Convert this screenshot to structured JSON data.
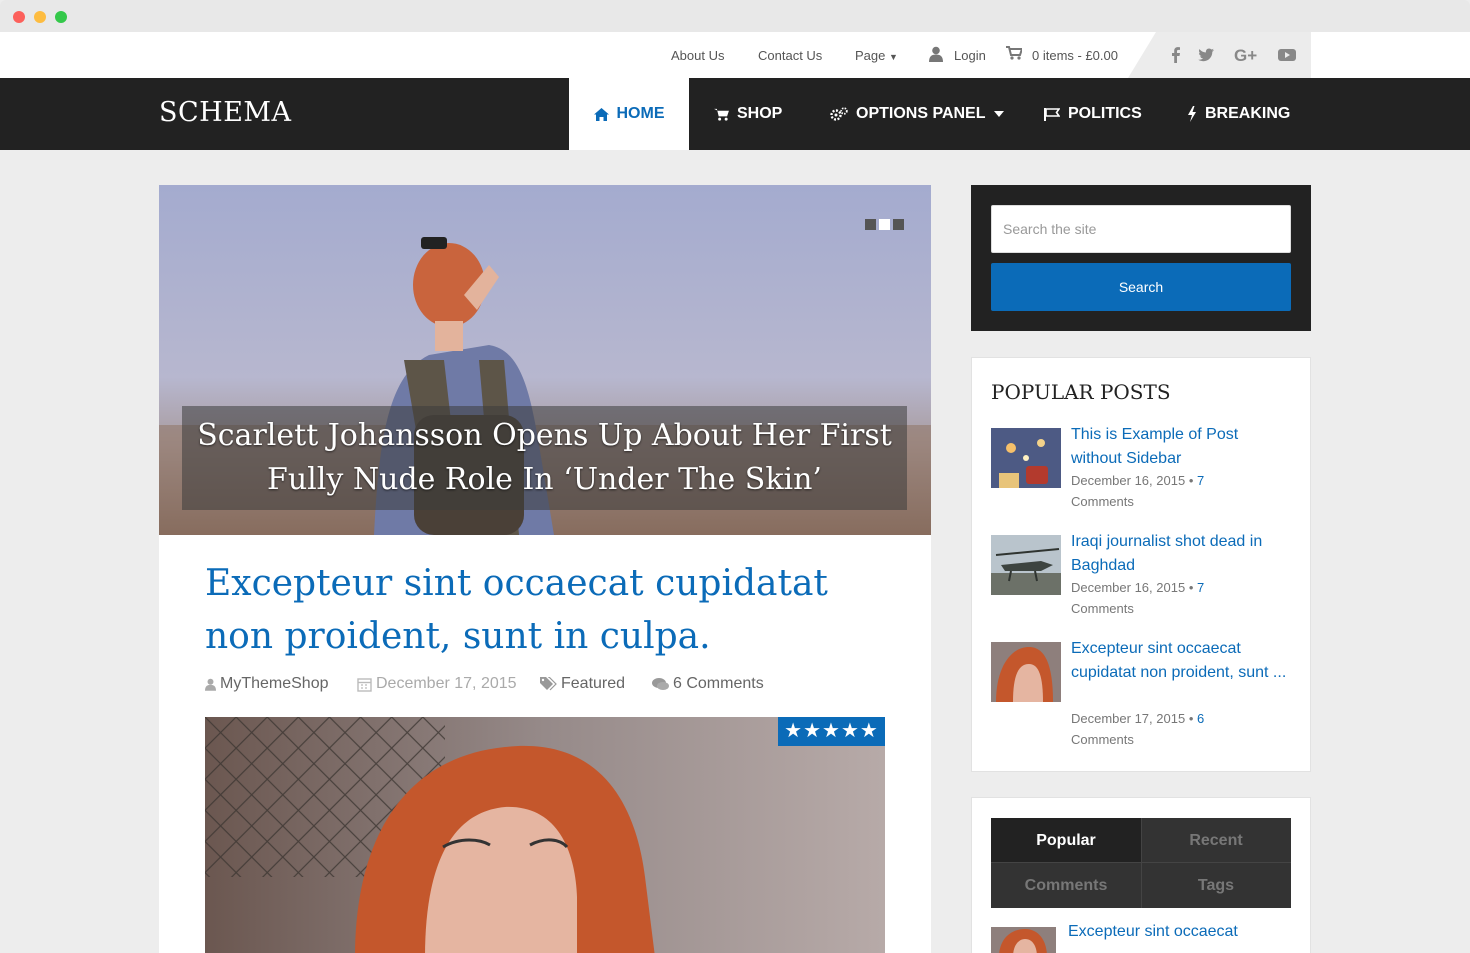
{
  "topbar": {
    "links": [
      "About Us",
      "Contact Us",
      "Page"
    ],
    "login": "Login",
    "cart": "0 items - £0.00",
    "social_icons": [
      "facebook-icon",
      "twitter-icon",
      "google-plus-icon",
      "youtube-icon"
    ]
  },
  "site": {
    "logo": "SCHEMA"
  },
  "nav": {
    "items": [
      {
        "label": "HOME",
        "icon": "home-icon"
      },
      {
        "label": "SHOP",
        "icon": "cart-icon"
      },
      {
        "label": "OPTIONS PANEL",
        "icon": "gears-icon"
      },
      {
        "label": "POLITICS",
        "icon": "flag-icon"
      },
      {
        "label": "BREAKING",
        "icon": "bolt-icon"
      }
    ]
  },
  "slider": {
    "caption": "Scarlett Johansson Opens Up About Her First Fully Nude Role In ‘Under The Skin’",
    "active_index": 1,
    "count": 3
  },
  "post": {
    "title": "Excepteur sint occaecat cupidatat non proident, sunt in culpa.",
    "author": "MyThemeShop",
    "date": "December 17, 2015",
    "category": "Featured",
    "comments": "6 Comments",
    "rating_stars": 5
  },
  "search": {
    "placeholder": "Search the site",
    "button": "Search"
  },
  "popular": {
    "title": "POPULAR POSTS",
    "posts": [
      {
        "title": "This is Example of Post without Sidebar",
        "date": "December 16, 2015",
        "sep": "•",
        "count": "7",
        "comments_label": "Comments"
      },
      {
        "title": "Iraqi journalist shot dead in Baghdad",
        "date": "December 16, 2015",
        "sep": "•",
        "count": "7",
        "comments_label": "Comments"
      },
      {
        "title": "Excepteur sint occaecat cupidatat non proident, sunt ...",
        "date": "December 17, 2015",
        "sep": "•",
        "count": "6",
        "comments_label": "Comments"
      }
    ]
  },
  "tabs_widget": {
    "tabs": [
      "Popular",
      "Recent",
      "Comments",
      "Tags"
    ],
    "first_post_title": "Excepteur sint occaecat"
  },
  "colors": {
    "accent": "#0b6bb8",
    "dark": "#222222"
  }
}
